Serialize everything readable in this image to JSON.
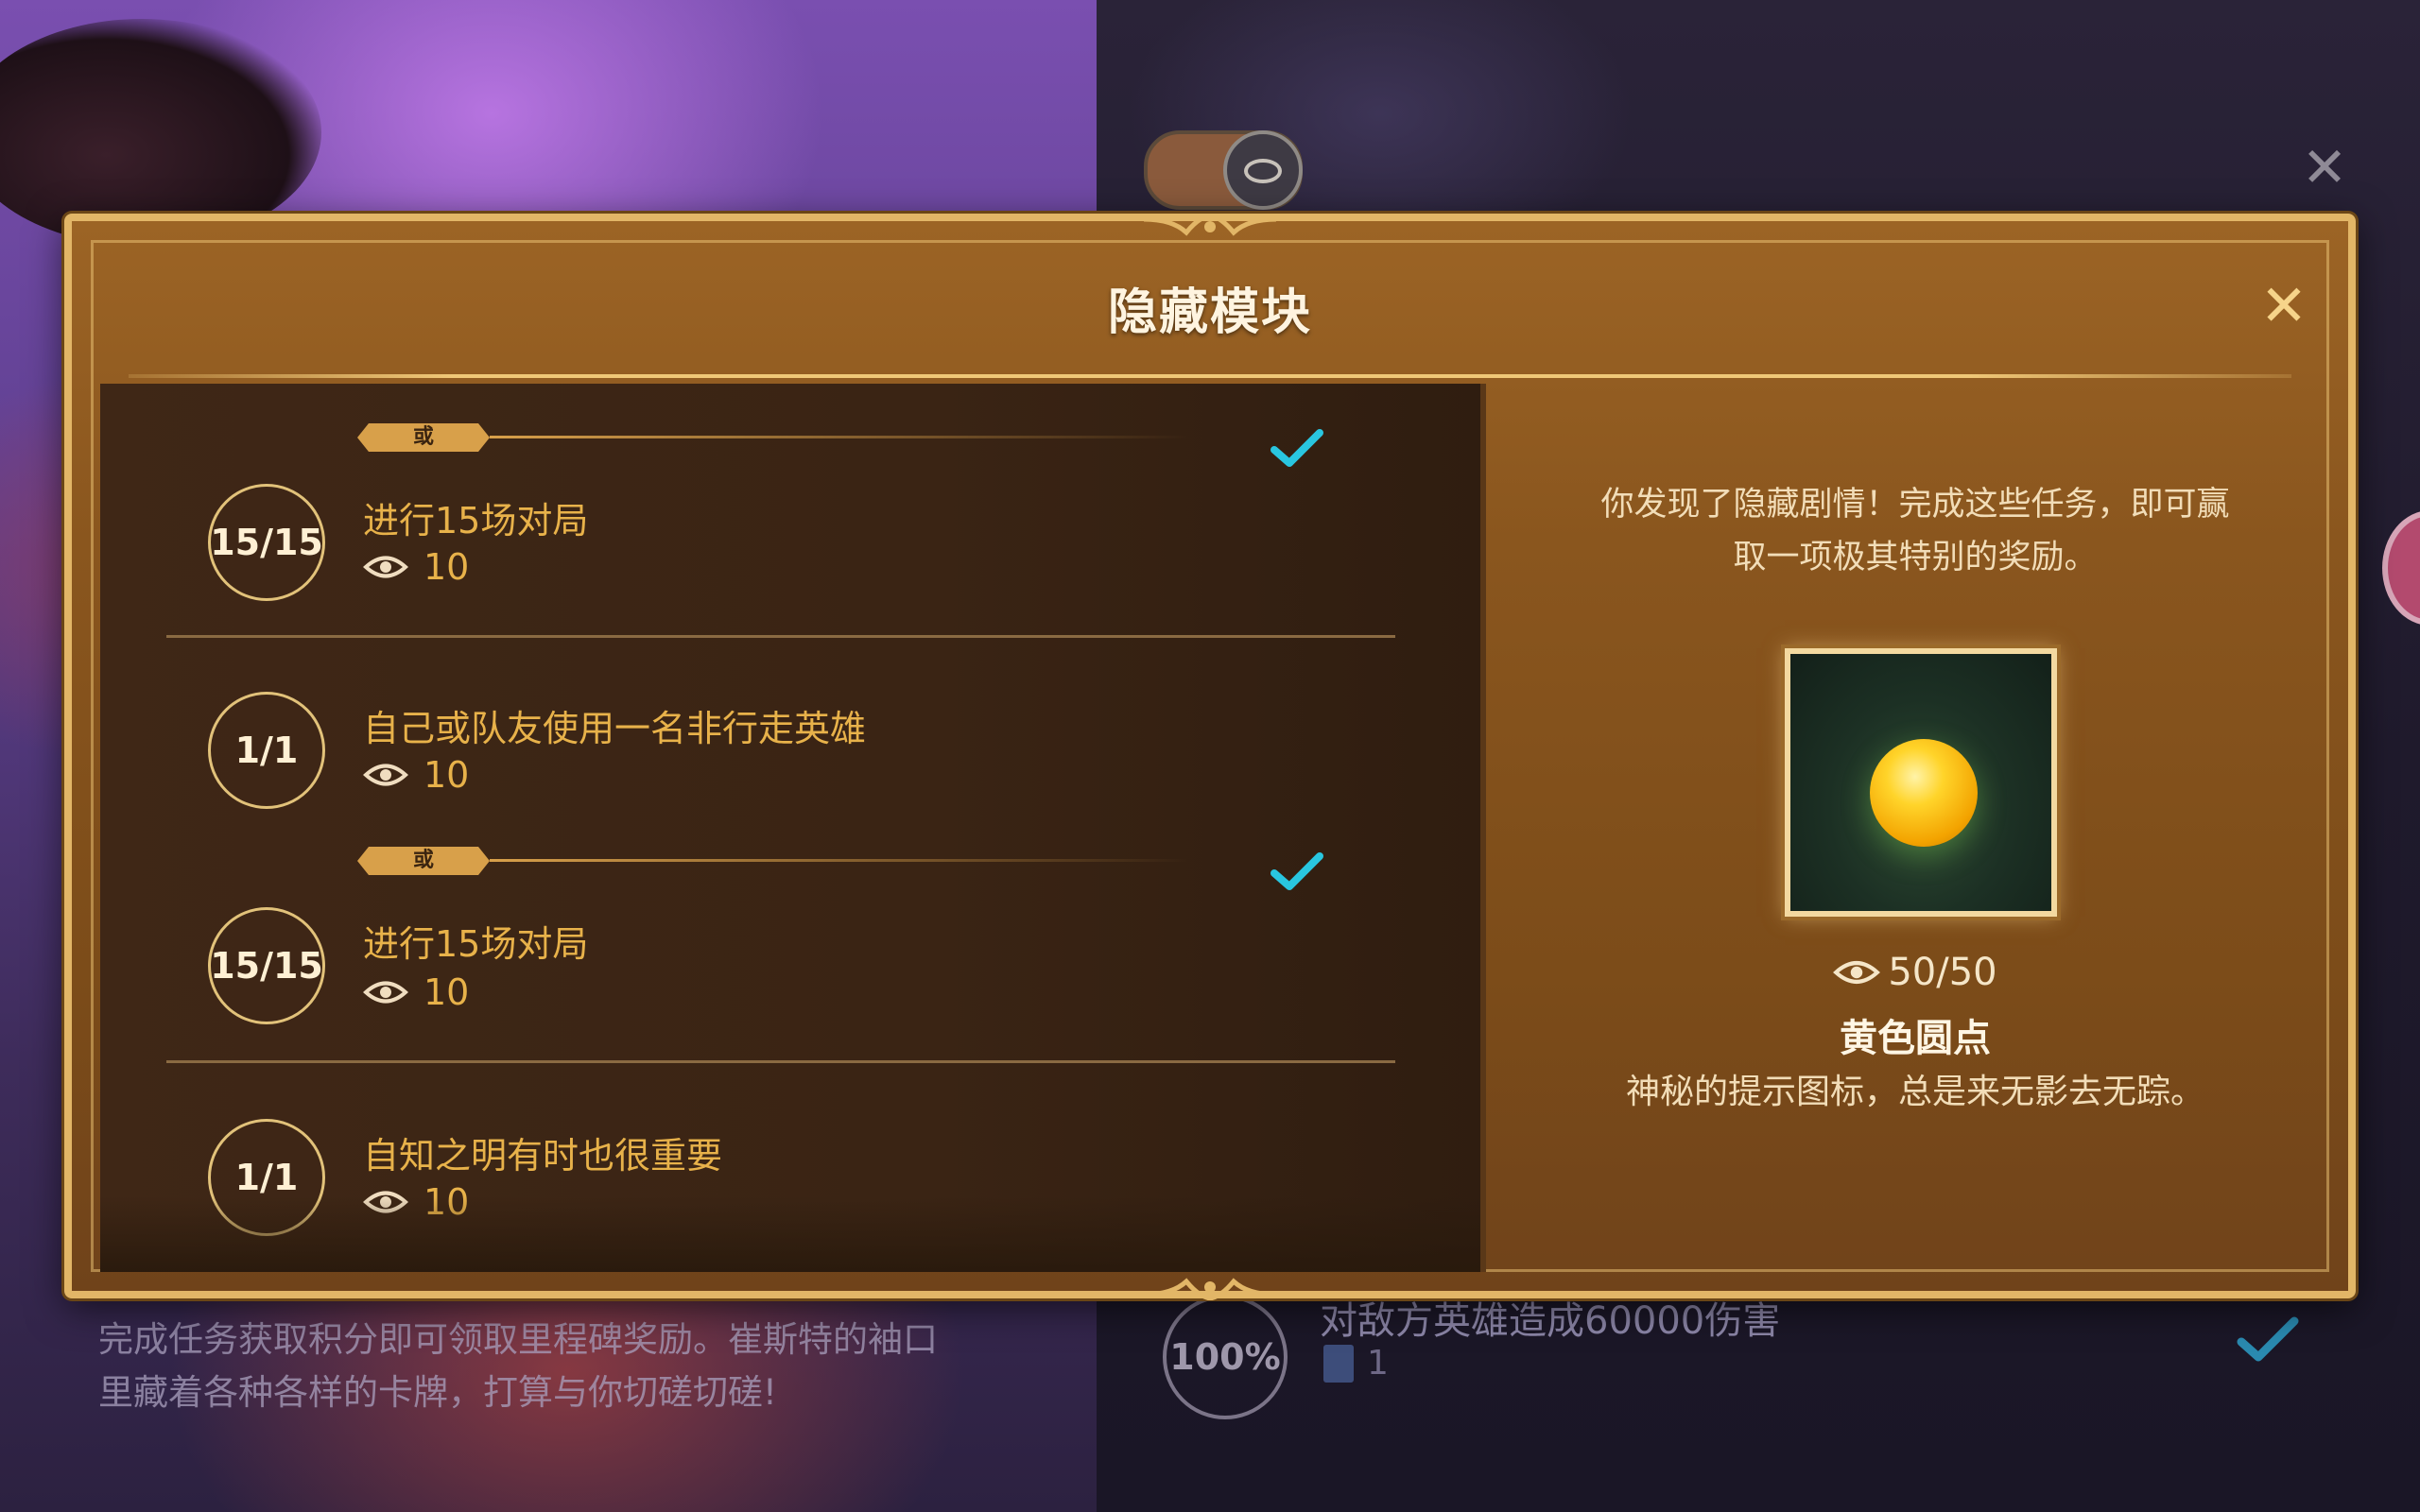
{
  "background": {
    "description_line1": "完成任务获取积分即可领取里程碑奖励。崔斯特的袖口",
    "description_line2": "里藏着各种各样的卡牌，打算与你切磋切磋!",
    "task_percent": "100%",
    "task_text": "对敌方英雄造成60000伤害",
    "task_reward": "1",
    "close_symbol": "✕"
  },
  "dialog": {
    "title": "隐藏模块",
    "close_symbol": "✕",
    "or_label": "或",
    "tasks": [
      {
        "progress": "15/15",
        "name": "进行15场对局",
        "reward": "10",
        "completed": true
      },
      {
        "progress": "1/1",
        "name": "自己或队友使用一名非行走英雄",
        "reward": "10",
        "completed": false
      },
      {
        "progress": "15/15",
        "name": "进行15场对局",
        "reward": "10",
        "completed": true
      },
      {
        "progress": "1/1",
        "name": "自知之明有时也很重要",
        "reward": "10",
        "completed": false
      }
    ],
    "reward": {
      "intro_line1": "你发现了隐藏剧情！完成这些任务，即可赢",
      "intro_line2": "取一项极其特别的奖励。",
      "cost": "50/50",
      "name": "黄色圆点",
      "description": "神秘的提示图标，总是来无影去无踪。"
    }
  },
  "colors": {
    "accent_gold": "#e8b24a",
    "check_cyan": "#29c6e0",
    "frame_gold": "#e2b667"
  },
  "icons": [
    "eye-icon",
    "check-icon",
    "close-icon",
    "toggle-eye-icon"
  ]
}
